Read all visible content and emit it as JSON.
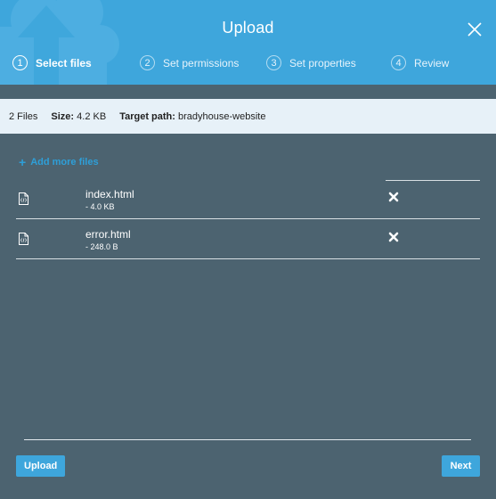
{
  "dialog": {
    "title": "Upload",
    "close_icon": "close-icon"
  },
  "steps": [
    {
      "number": "1",
      "label": "Select files",
      "active": true
    },
    {
      "number": "2",
      "label": "Set permissions",
      "active": false
    },
    {
      "number": "3",
      "label": "Set properties",
      "active": false
    },
    {
      "number": "4",
      "label": "Review",
      "active": false
    }
  ],
  "summary": {
    "files_count": "2 Files",
    "size_label": "Size:",
    "size_value": "4.2 KB",
    "target_label": "Target path:",
    "target_value": "bradyhouse-website"
  },
  "add_more": {
    "icon": "plus-icon",
    "label": "Add more files"
  },
  "files": [
    {
      "name": "index.html",
      "size": "- 4.0 KB",
      "icon": "html-file-icon"
    },
    {
      "name": "error.html",
      "size": "- 248.0 B",
      "icon": "html-file-icon"
    }
  ],
  "footer": {
    "upload_label": "Upload",
    "next_label": "Next"
  },
  "colors": {
    "header": "#3ea6dc",
    "body": "#4c6370",
    "info_bar": "#e7f1f8",
    "accent": "#2e9fd8"
  }
}
